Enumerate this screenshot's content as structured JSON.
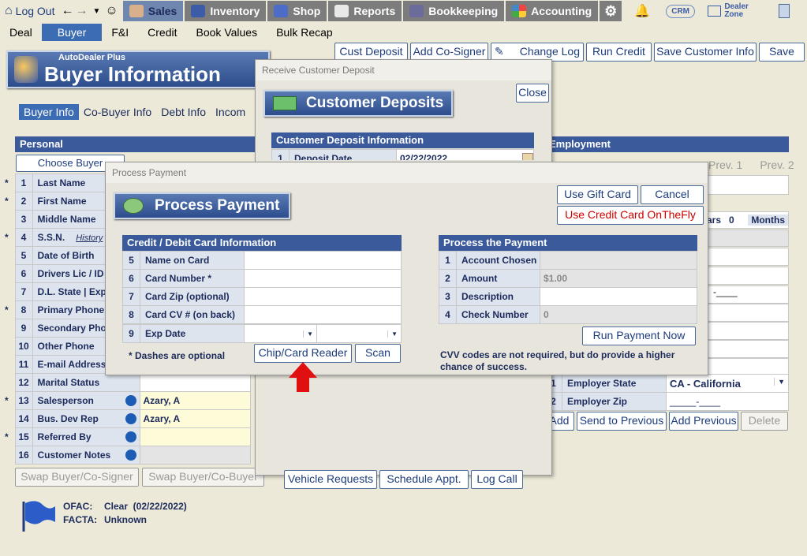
{
  "nav": {
    "logout": "Log Out",
    "sales": "Sales",
    "inventory": "Inventory",
    "shop": "Shop",
    "reports": "Reports",
    "bookkeeping": "Bookkeeping",
    "accounting": "Accounting",
    "crm": "CRM",
    "dealer_zone": "Dealer Zone"
  },
  "subnav": [
    "Deal",
    "Buyer",
    "F&I",
    "Credit",
    "Book Values",
    "Bulk Recap"
  ],
  "toolbar": {
    "cust_deposit": "Cust Deposit",
    "add_cosigner": "Add Co-Signer",
    "change_log": "Change Log",
    "run_credit": "Run Credit",
    "save_customer_info": "Save Customer Info",
    "save": "Save"
  },
  "page": {
    "app_label": "AutoDealer Plus",
    "title": "Buyer Information"
  },
  "tabs": [
    "Buyer Info",
    "Co-Buyer Info",
    "Debt Info",
    "Incom"
  ],
  "personal": {
    "header": "Personal",
    "choose_buyer": "Choose Buyer",
    "rows": [
      {
        "n": "1",
        "label": "Last Name",
        "req": true,
        "value": ""
      },
      {
        "n": "2",
        "label": "First Name",
        "req": true,
        "value": ""
      },
      {
        "n": "3",
        "label": "Middle Name",
        "req": false,
        "value": ""
      },
      {
        "n": "4",
        "label": "S.S.N.",
        "req": true,
        "value": "",
        "history": "History"
      },
      {
        "n": "5",
        "label": "Date of Birth",
        "req": false,
        "value": ""
      },
      {
        "n": "6",
        "label": "Drivers Lic / ID",
        "req": false,
        "value": ""
      },
      {
        "n": "7",
        "label": "D.L. State | Exp",
        "req": false,
        "value": ""
      },
      {
        "n": "8",
        "label": "Primary Phone",
        "req": true,
        "value": ""
      },
      {
        "n": "9",
        "label": "Secondary Pho",
        "req": false,
        "value": ""
      },
      {
        "n": "10",
        "label": "Other Phone",
        "req": false,
        "value": ""
      },
      {
        "n": "11",
        "label": "E-mail Address",
        "req": false,
        "value": ""
      },
      {
        "n": "12",
        "label": "Marital Status",
        "req": false,
        "value": ""
      },
      {
        "n": "13",
        "label": "Salesperson",
        "req": true,
        "value": "Azary, A"
      },
      {
        "n": "14",
        "label": "Bus. Dev Rep",
        "req": false,
        "value": "Azary, A"
      },
      {
        "n": "15",
        "label": "Referred By",
        "req": true,
        "value": ""
      },
      {
        "n": "16",
        "label": "Customer Notes",
        "req": false,
        "value": ""
      }
    ],
    "swap1": "Swap Buyer/Co-Signer",
    "swap2": "Swap Buyer/Co-Buyer"
  },
  "ofac": {
    "ofac_label": "OFAC:",
    "ofac_value": "Clear  (02/22/2022)",
    "facta_label": "FACTA:",
    "facta_value": "Unknown"
  },
  "employment": {
    "header": "Employment",
    "prev1": "Prev. 1",
    "prev2": "Prev. 2",
    "years_label": "ars",
    "years_value": "0",
    "months_label": "Months",
    "phone_frag": "-____",
    "state_num": "1",
    "state_label": "Employer State",
    "state_value": "CA - California",
    "zip_num": "2",
    "zip_label": "Employer Zip",
    "zip_value": "_____-____",
    "add": "Add",
    "send_prev": "Send to Previous",
    "add_prev": "Add Previous",
    "delete": "Delete"
  },
  "bottom_btns": {
    "vehicle_requests": "Vehicle Requests",
    "schedule_appt": "Schedule Appt.",
    "log_call": "Log Call"
  },
  "deposit_dialog": {
    "title": "Receive Customer Deposit",
    "banner": "Customer Deposits",
    "close": "Close",
    "section": "Customer Deposit Information",
    "row1_num": "1",
    "row1_label": "Deposit Date",
    "row1_value": "02/22/2022"
  },
  "payment_dialog": {
    "title": "Process Payment",
    "banner": "Process Payment",
    "use_gift_card": "Use Gift Card",
    "cancel": "Cancel",
    "use_credit_card": "Use Credit Card OnTheFly",
    "card_section": "Credit / Debit Card Information",
    "card_rows": [
      {
        "n": "5",
        "label": "Name on Card",
        "value": ""
      },
      {
        "n": "6",
        "label": "Card Number *",
        "value": ""
      },
      {
        "n": "7",
        "label": "Card Zip (optional)",
        "value": ""
      },
      {
        "n": "8",
        "label": "Card CV # (on back)",
        "value": ""
      }
    ],
    "exp_num": "9",
    "exp_label": "Exp Date",
    "dashes_note": "* Dashes are optional",
    "chip_reader": "Chip/Card Reader",
    "scan": "Scan",
    "process_section": "Process the Payment",
    "process_rows": [
      {
        "n": "1",
        "label": "Account Chosen",
        "value": ""
      },
      {
        "n": "2",
        "label": "Amount",
        "value": "$1.00"
      },
      {
        "n": "3",
        "label": "Description",
        "value": ""
      },
      {
        "n": "4",
        "label": "Check Number",
        "value": "0"
      }
    ],
    "run_payment": "Run Payment Now",
    "cvv_note": "CVV codes are not required, but do provide a higher chance of success."
  },
  "colors": {
    "nav_active": "#6F86AE",
    "header_blue": "#3A5A9C",
    "required": "#CC0000",
    "arrow": "#E01010"
  }
}
